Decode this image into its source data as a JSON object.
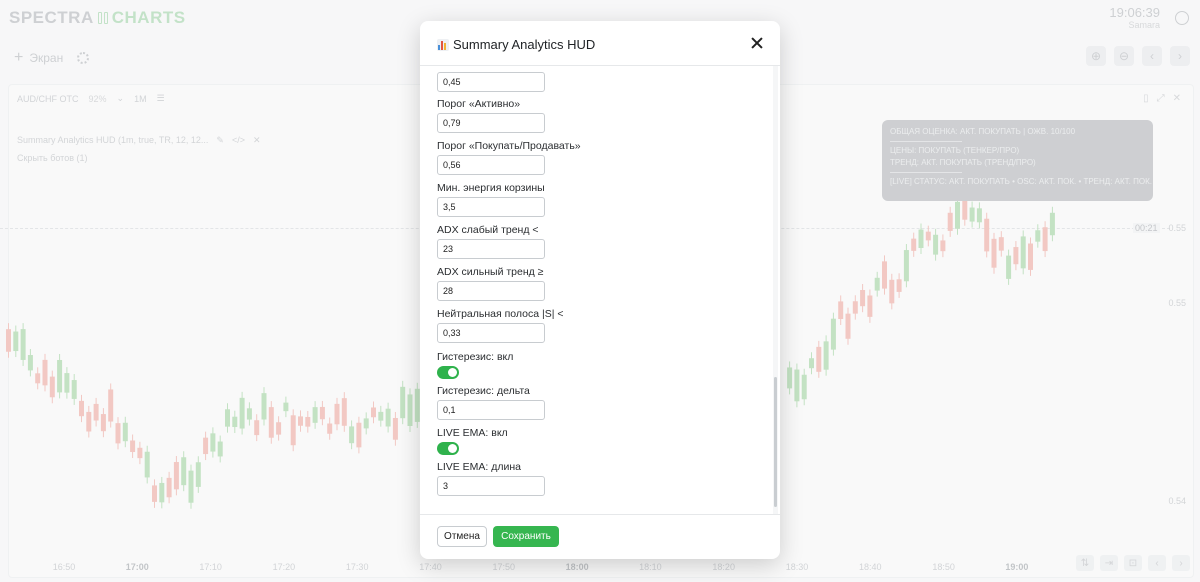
{
  "app": {
    "logo_left": "SPECTRA",
    "logo_right": "CHARTS",
    "time": "19:06:39",
    "city": "Samara"
  },
  "toolbar": {
    "screen_label": "Экран"
  },
  "chart": {
    "pair": "AUD/CHF OTC",
    "payout": "92%",
    "timeframe": "1M",
    "indicator_label": "Summary Analytics HUD (1m, true, TR, 12, 12...",
    "hide_bots": "Скрыть ботов (1)",
    "crosshair_time": "00:21",
    "prices": [
      "0.55",
      "0.55",
      "0.54"
    ],
    "time_ticks": [
      "16:50",
      "17:00",
      "17:10",
      "17:20",
      "17:30",
      "17:40",
      "17:50",
      "18:00",
      "18:10",
      "18:20",
      "18:30",
      "18:40",
      "18:50",
      "19:00"
    ],
    "up_color": "#a8d8a8",
    "down_color": "#f0b0a8"
  },
  "hud": {
    "line1": "ОБЩАЯ ОЦЕНКА: АКТ. ПОКУПАТЬ | ОЖВ. 10/100",
    "line2": "ЦЕНЫ: ПОКУПАТЬ (ТЕНКЕР/ПРО)",
    "line3": "ТРЕНД: АКТ. ПОКУПАТЬ (ТРЕНД/ПРО)",
    "line4": "[LIVE] СТАТУС: АКТ. ПОКУПАТЬ • OSC: АКТ. ПОК. • ТРЕНД: АКТ. ПОК."
  },
  "modal": {
    "title": "Summary Analytics HUD",
    "top_value": "0,45",
    "fields": [
      {
        "label": "Порог «Активно»",
        "value": "0,79"
      },
      {
        "label": "Порог «Покупать/Продавать»",
        "value": "0,56"
      },
      {
        "label": "Мин. энергия корзины",
        "value": "3,5"
      },
      {
        "label": "ADX слабый тренд <",
        "value": "23"
      },
      {
        "label": "ADX сильный тренд ≥",
        "value": "28"
      },
      {
        "label": "Нейтральная полоса |S| <",
        "value": "0,33"
      }
    ],
    "hyst_toggle_label": "Гистерезис: вкл",
    "hyst_delta_label": "Гистерезис: дельта",
    "hyst_delta_value": "0,1",
    "ema_toggle_label": "LIVE EMA: вкл",
    "ema_len_label": "LIVE EMA: длина",
    "ema_len_value": "3",
    "cancel_label": "Отмена",
    "save_label": "Сохранить"
  }
}
